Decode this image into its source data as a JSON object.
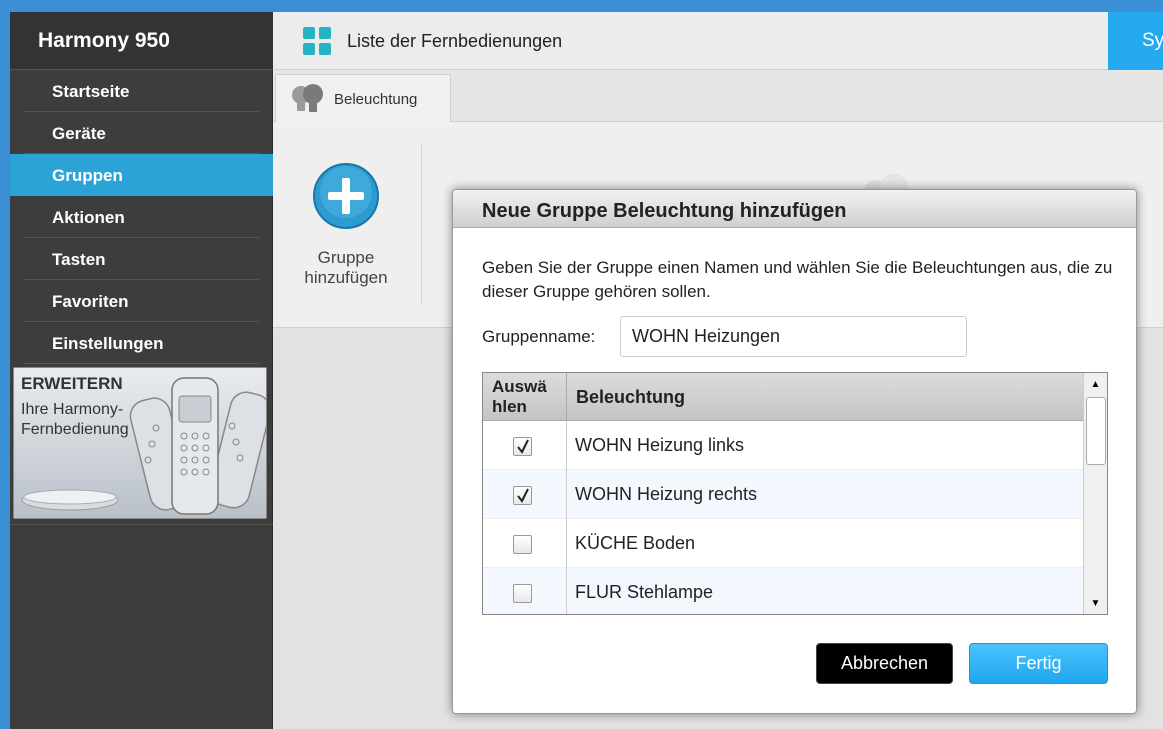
{
  "sidebar": {
    "title": "Harmony 950",
    "items": [
      {
        "label": "Startseite"
      },
      {
        "label": "Geräte"
      },
      {
        "label": "Gruppen"
      },
      {
        "label": "Aktionen"
      },
      {
        "label": "Tasten"
      },
      {
        "label": "Favoriten"
      },
      {
        "label": "Einstellungen"
      }
    ],
    "active_item": "Gruppen",
    "promo": {
      "title": "ERWEITERN",
      "subtitle": "Ihre Harmony-Fernbedienung"
    }
  },
  "topbar": {
    "remote_list_label": "Liste der Fernbedienungen",
    "sync_label": "Sy"
  },
  "tabs": [
    {
      "label": "Beleuchtung",
      "icon": "bulbs-icon"
    }
  ],
  "content": {
    "add_group_label": "Gruppe hinzufügen"
  },
  "modal": {
    "title": "Neue Gruppe Beleuchtung hinzufügen",
    "description": "Geben Sie der Gruppe einen Namen und wählen Sie die Beleuchtungen aus, die zu dieser Gruppe gehören sollen.",
    "name_label": "Gruppenname:",
    "name_value": "WOHN Heizungen",
    "table": {
      "headers": {
        "select": "Auswä hlen",
        "name": "Beleuchtung"
      },
      "rows": [
        {
          "name": "WOHN Heizung links",
          "checked": true
        },
        {
          "name": "WOHN Heizung rechts",
          "checked": true
        },
        {
          "name": "KÜCHE Boden",
          "checked": false
        },
        {
          "name": "FLUR Stehlampe",
          "checked": false
        }
      ]
    },
    "cancel_label": "Abbrechen",
    "done_label": "Fertig"
  },
  "colors": {
    "accent": "#2ba3d6",
    "sidebar_bg": "#3d3d3d",
    "primary_button": "#25aaf0"
  }
}
